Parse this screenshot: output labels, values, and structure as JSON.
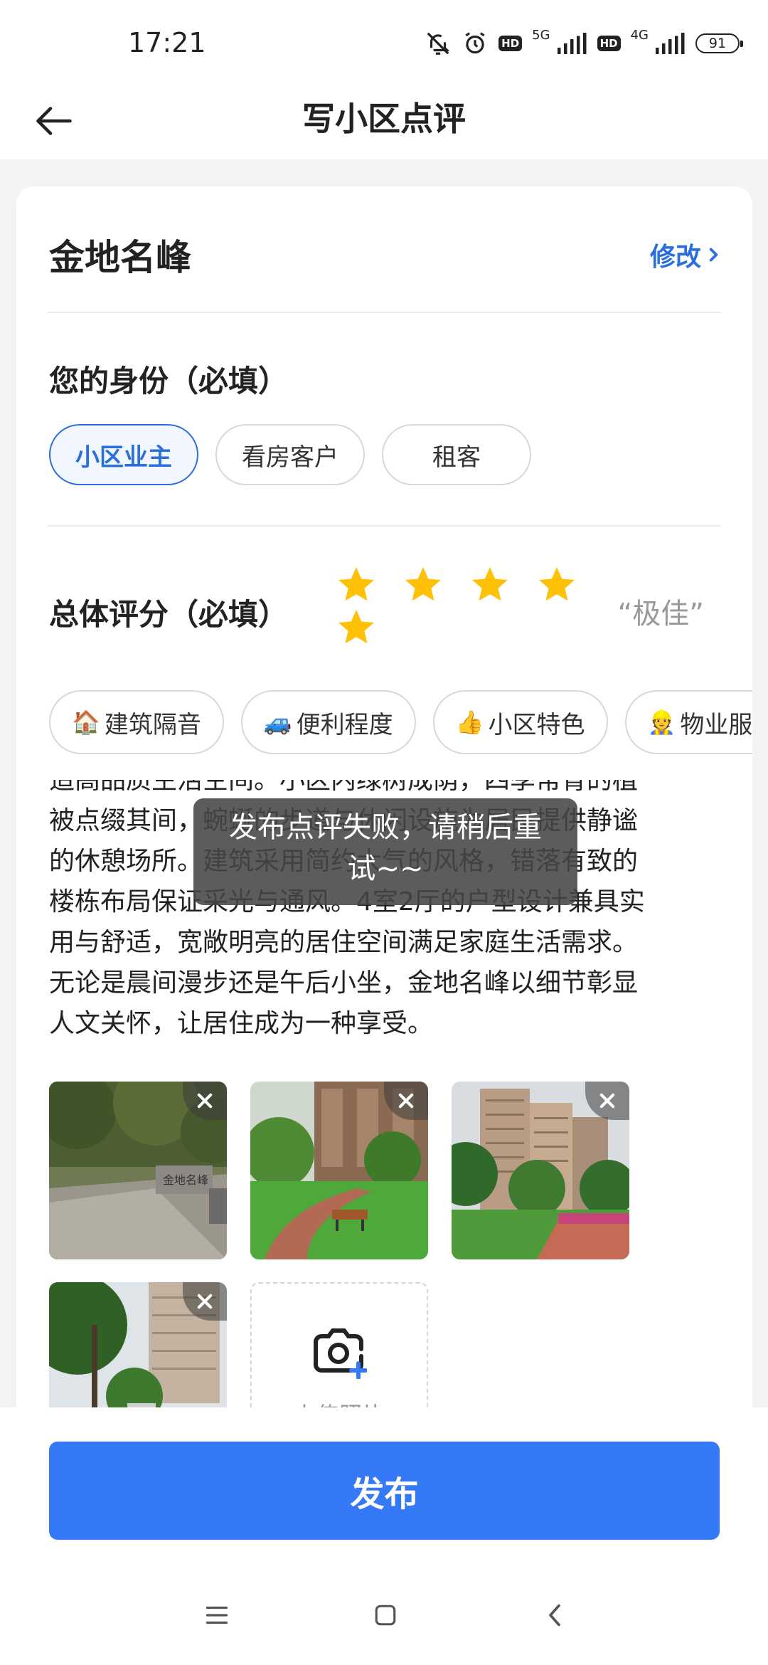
{
  "status_bar": {
    "time": "17:21",
    "net1": "5G",
    "net2": "4G",
    "hd": "HD",
    "battery": "91"
  },
  "header": {
    "title": "写小区点评"
  },
  "community": {
    "name": "金地名峰",
    "edit_label": "修改"
  },
  "identity": {
    "title": "您的身份（必填）",
    "options": [
      "小区业主",
      "看房客户",
      "租客"
    ],
    "selected": "小区业主"
  },
  "rating": {
    "title": "总体评分（必填）",
    "stars": 5,
    "max_stars": 5,
    "text": "“极佳”",
    "star_color": "#ffc107"
  },
  "tags": [
    {
      "emoji": "🏠",
      "label": "建筑隔音"
    },
    {
      "emoji": "🚙",
      "label": "便利程度"
    },
    {
      "emoji": "👍",
      "label": "小区特色"
    },
    {
      "emoji": "👷",
      "label": "物业服务"
    }
  ],
  "review": {
    "lines": [
      "造高品质生活空间。小区内绿树成荫，四季常青的植",
      "被点缀其间，蜿蜒的步道与休闲设施为居民提供静谧",
      "的休憩场所。建筑采用简约大气的风格，错落有致的",
      "楼栋布局保证采光与通风。4室2厅的户型设计兼具实",
      "用与舒适，宽敞明亮的居住空间满足家庭生活需求。",
      "无论是晨间漫步还是午后小坐，金地名峰以细节彰显",
      "人文关怀，让居住成为一种享受。"
    ]
  },
  "photos": {
    "items": [
      {
        "name": "photo-entrance",
        "sign": "金地名峰"
      },
      {
        "name": "photo-garden-path"
      },
      {
        "name": "photo-towers"
      },
      {
        "name": "photo-garden-2"
      }
    ],
    "upload_label": "上传照片"
  },
  "toast": {
    "message": "发布点评失败，请稍后重试~~"
  },
  "actions": {
    "publish_label": "发布",
    "accent": "#3579f6",
    "link_color": "#2a6fdc"
  }
}
